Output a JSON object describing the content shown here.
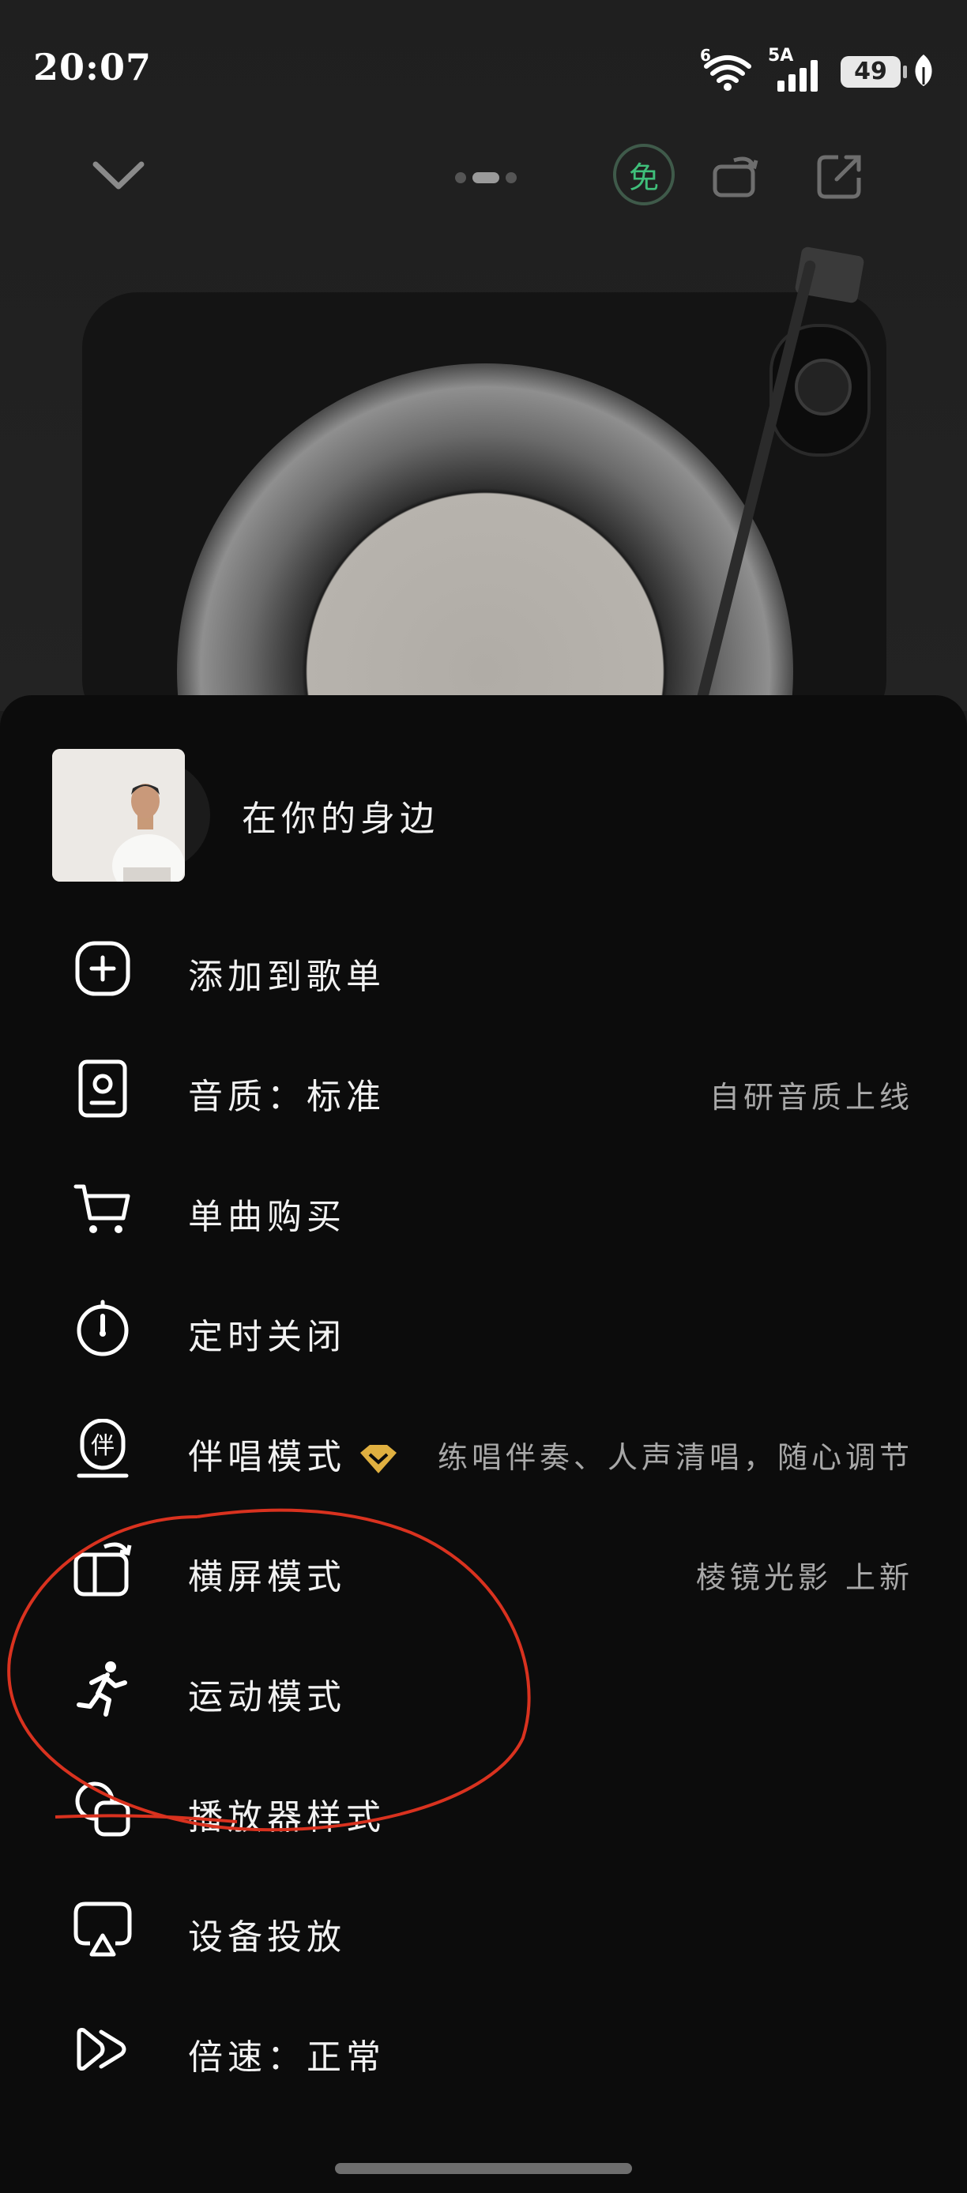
{
  "status_bar": {
    "time": "20:07",
    "wifi_tag": "6",
    "signal_tag": "5A",
    "battery": "49"
  },
  "top_controls": {
    "free_badge": "免",
    "icons": [
      "chevron-down-icon",
      "free-badge-icon",
      "landscape-switch-icon",
      "share-icon"
    ]
  },
  "song": {
    "title": "在你的身边"
  },
  "menu": [
    {
      "icon": "add-circle-icon",
      "label": "添加到歌单",
      "aside": ""
    },
    {
      "icon": "audio-quality-icon",
      "label": "音质：标准",
      "aside": "自研音质上线"
    },
    {
      "icon": "cart-icon",
      "label": "单曲购买",
      "aside": ""
    },
    {
      "icon": "timer-icon",
      "label": "定时关闭",
      "aside": ""
    },
    {
      "icon": "karaoke-icon",
      "label": "伴唱模式",
      "aside": "练唱伴奏、人声清唱，随心调节",
      "vip": true
    },
    {
      "icon": "landscape-icon",
      "label": "横屏模式",
      "aside": "棱镜光影 上新"
    },
    {
      "icon": "running-icon",
      "label": "运动模式",
      "aside": ""
    },
    {
      "icon": "player-style-icon",
      "label": "播放器样式",
      "aside": ""
    },
    {
      "icon": "cast-icon",
      "label": "设备投放",
      "aside": ""
    },
    {
      "icon": "speed-icon",
      "label": "倍速：正常",
      "aside": ""
    }
  ],
  "colors": {
    "sheet_bg": "#0c0c0c",
    "accent_green": "#3fbf7a",
    "vip_gold": "#e0b040",
    "annotation_red": "#d9321f"
  }
}
